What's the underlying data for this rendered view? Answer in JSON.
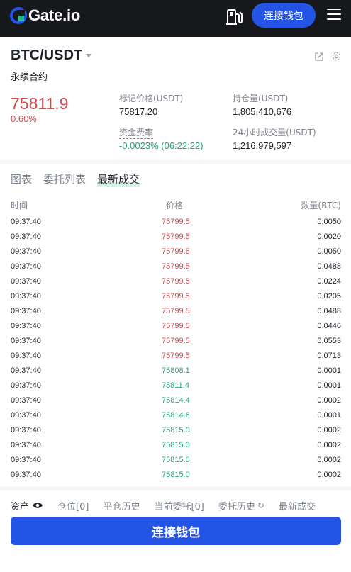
{
  "header": {
    "logo_text": "Gate.io",
    "connect_wallet_label": "连接钱包"
  },
  "market": {
    "pair": "BTC/USDT",
    "contract_type": "永续合约",
    "last_price": "75811.9",
    "change": "0.60%",
    "mark_price_label": "标记价格(USDT)",
    "mark_price": "75817.20",
    "open_interest_label": "持仓量(USDT)",
    "open_interest": "1,805,410,676",
    "funding_rate_label": "资金费率",
    "funding_rate": "-0.0023% (06:22:22)",
    "volume_24h_label": "24小时成交量(USDT)",
    "volume_24h": "1,216,979,597"
  },
  "tabs": [
    {
      "label": "图表"
    },
    {
      "label": "委托列表"
    },
    {
      "label": "最新成交"
    }
  ],
  "trades_table": {
    "headers": {
      "time": "时间",
      "price": "价格",
      "amount": "数量(BTC)"
    },
    "rows": [
      {
        "time": "09:37:40",
        "price": "75799.5",
        "amount": "0.0050",
        "side": "sell"
      },
      {
        "time": "09:37:40",
        "price": "75799.5",
        "amount": "0.0020",
        "side": "sell"
      },
      {
        "time": "09:37:40",
        "price": "75799.5",
        "amount": "0.0050",
        "side": "sell"
      },
      {
        "time": "09:37:40",
        "price": "75799.5",
        "amount": "0.0488",
        "side": "sell"
      },
      {
        "time": "09:37:40",
        "price": "75799.5",
        "amount": "0.0224",
        "side": "sell"
      },
      {
        "time": "09:37:40",
        "price": "75799.5",
        "amount": "0.0205",
        "side": "sell"
      },
      {
        "time": "09:37:40",
        "price": "75799.5",
        "amount": "0.0488",
        "side": "sell"
      },
      {
        "time": "09:37:40",
        "price": "75799.5",
        "amount": "0.0446",
        "side": "sell"
      },
      {
        "time": "09:37:40",
        "price": "75799.5",
        "amount": "0.0553",
        "side": "sell"
      },
      {
        "time": "09:37:40",
        "price": "75799.5",
        "amount": "0.0713",
        "side": "sell"
      },
      {
        "time": "09:37:40",
        "price": "75808.1",
        "amount": "0.0001",
        "side": "buy"
      },
      {
        "time": "09:37:40",
        "price": "75811.4",
        "amount": "0.0001",
        "side": "buy"
      },
      {
        "time": "09:37:40",
        "price": "75814.4",
        "amount": "0.0002",
        "side": "buy"
      },
      {
        "time": "09:37:40",
        "price": "75814.6",
        "amount": "0.0001",
        "side": "buy"
      },
      {
        "time": "09:37:40",
        "price": "75815.0",
        "amount": "0.0002",
        "side": "buy"
      },
      {
        "time": "09:37:40",
        "price": "75815.0",
        "amount": "0.0002",
        "side": "buy"
      },
      {
        "time": "09:37:40",
        "price": "75815.0",
        "amount": "0.0002",
        "side": "buy"
      },
      {
        "time": "09:37:40",
        "price": "75815.0",
        "amount": "0.0002",
        "side": "buy"
      }
    ]
  },
  "bottom_tabs": [
    {
      "label": "资产"
    },
    {
      "label": "仓位[0]"
    },
    {
      "label": "平仓历史"
    },
    {
      "label": "当前委托[0]"
    },
    {
      "label": "委托历史"
    },
    {
      "label": "最新成交"
    }
  ],
  "colors": {
    "accent": "#2354e6",
    "sell": "#d04a4f",
    "buy": "#22a773",
    "topbar": "#17181c"
  },
  "icons": [
    "gate-logo-icon",
    "fuel-pump-icon",
    "menu-icon",
    "caret-down-icon",
    "external-link-icon",
    "settings-icon",
    "eye-icon",
    "refresh-icon"
  ]
}
